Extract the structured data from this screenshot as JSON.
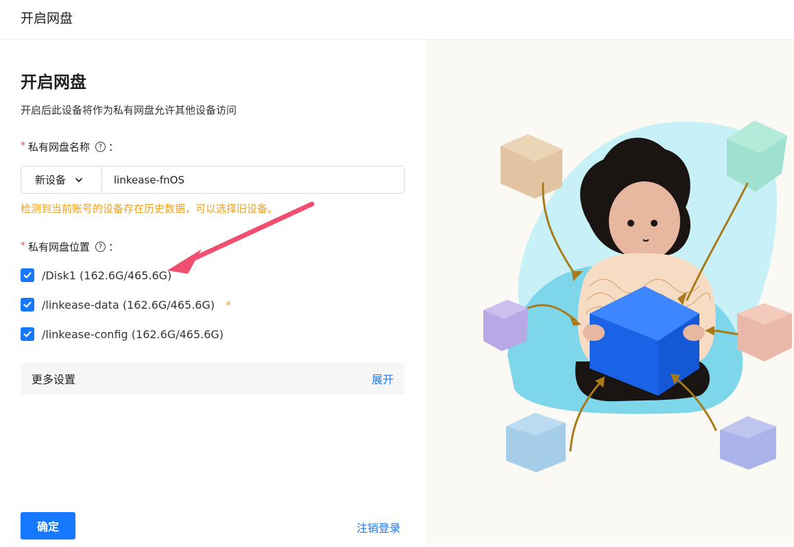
{
  "topbar": {
    "title": "开启网盘"
  },
  "form": {
    "heading": "开启网盘",
    "subtitle": "开启后此设备将作为私有网盘允许其他设备访问",
    "name_field": {
      "required_mark": "*",
      "label": "私有网盘名称",
      "help_icon": "question-circle-icon",
      "colon": "：",
      "select_value": "新设备",
      "input_value": "linkease-fnOS"
    },
    "warning": "检测到当前账号的设备存在历史数据，可以选择旧设备。",
    "location_field": {
      "required_mark": "*",
      "label": "私有网盘位置",
      "help_icon": "question-circle-icon",
      "colon": "：",
      "options": [
        {
          "label": "/Disk1 (162.6G/465.6G)",
          "checked": true,
          "mark": ""
        },
        {
          "label": "/linkease-data (162.6G/465.6G)",
          "checked": true,
          "mark": "*"
        },
        {
          "label": "/linkease-config (162.6G/465.6G)",
          "checked": true,
          "mark": ""
        }
      ]
    },
    "more_settings": {
      "label": "更多设置",
      "toggle": "展开"
    },
    "confirm_label": "确定",
    "logout_label": "注销登录"
  },
  "colors": {
    "primary": "#1677ff",
    "warning": "#f0a020",
    "required": "#f04a3a",
    "annotation_arrow": "#f0506e",
    "illustration_bg": "#fbf9f4"
  }
}
